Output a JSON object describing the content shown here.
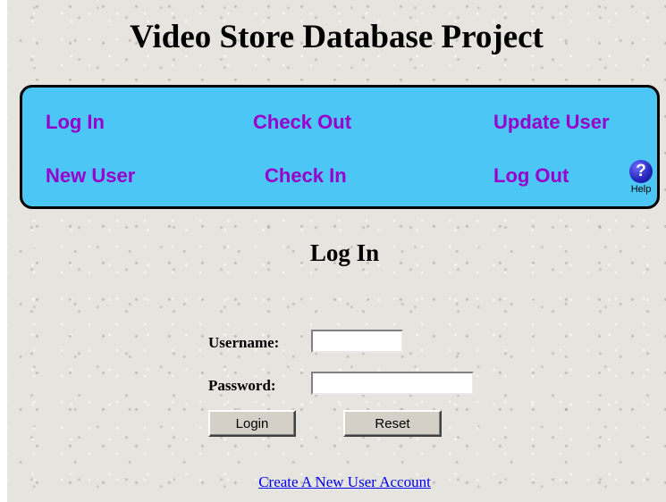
{
  "page": {
    "title": "Video Store Database Project"
  },
  "nav": {
    "items": [
      {
        "label": "Log In"
      },
      {
        "label": "Check Out"
      },
      {
        "label": "Update User"
      },
      {
        "label": "New User"
      },
      {
        "label": "Check In"
      },
      {
        "label": "Log Out"
      }
    ],
    "help": {
      "icon": "help-question-icon",
      "glyph": "?",
      "label": "Help"
    },
    "background_color": "#4cc6f4",
    "link_color": "#9900cc"
  },
  "login": {
    "heading": "Log In",
    "username_label": "Username",
    "password_label": "Password",
    "colon": ":",
    "username_value": "",
    "password_value": "",
    "login_button": "Login",
    "reset_button": "Reset"
  },
  "footer": {
    "create_account_link": "Create A New User Account",
    "link_color": "#0000ee"
  }
}
